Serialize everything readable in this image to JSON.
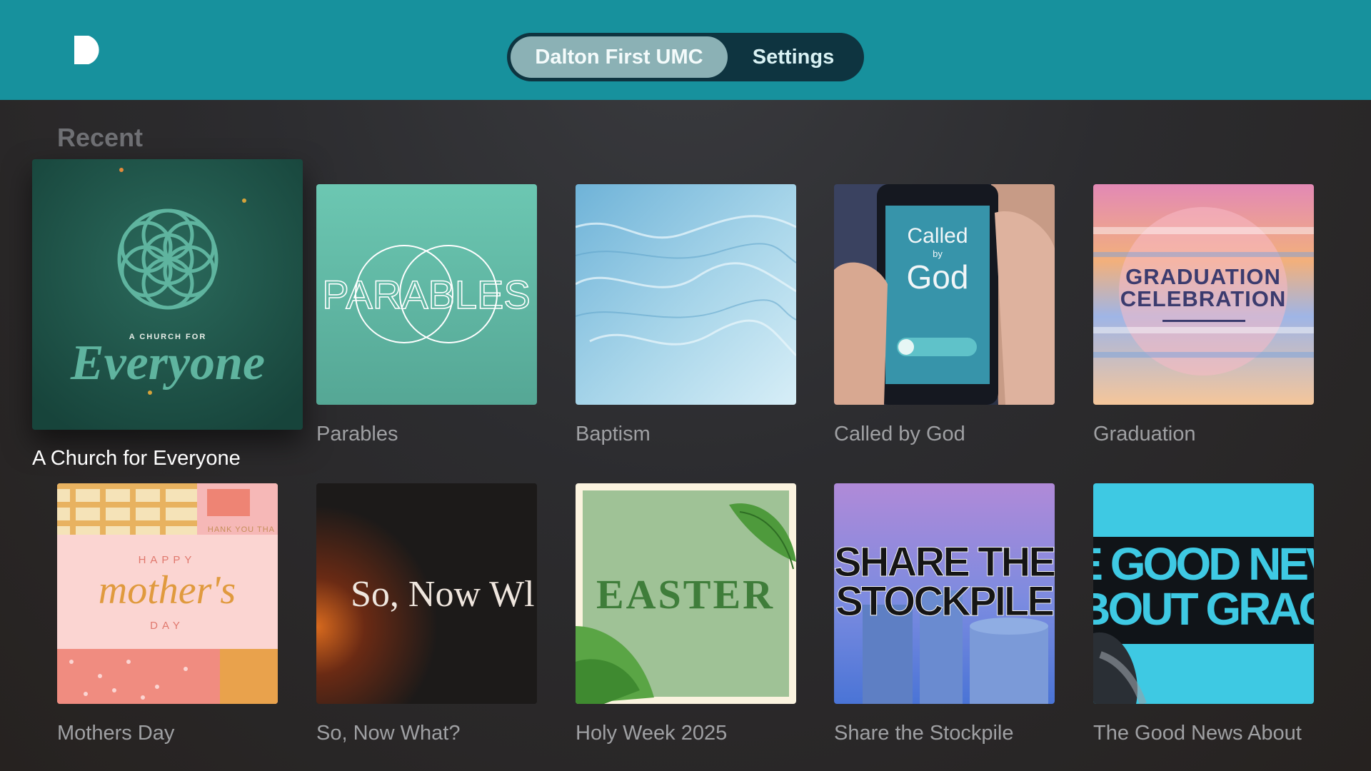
{
  "header": {
    "logo_icon": "app-logo-d-icon",
    "tabs": [
      {
        "label": "Dalton First UMC",
        "active": true
      },
      {
        "label": "Settings",
        "active": false
      }
    ]
  },
  "recent": {
    "title": "Recent",
    "items": [
      {
        "label": "A Church for Everyone",
        "focused": true,
        "art_text": [
          "A CHURCH FOR",
          "Everyone"
        ]
      },
      {
        "label": "Parables",
        "art_text": [
          "PARABLES"
        ]
      },
      {
        "label": "Baptism",
        "art_text": []
      },
      {
        "label": "Called by God",
        "art_text": [
          "Called",
          "by",
          "God"
        ]
      },
      {
        "label": "Graduation",
        "art_text": [
          "GRADUATION",
          "CELEBRATION"
        ]
      },
      {
        "label": "Mothers Day",
        "art_text": [
          "HAPPY",
          "mother's",
          "DAY",
          "HANK YOU THA"
        ]
      },
      {
        "label": "So, Now What?",
        "art_text": [
          "So, Now Wl"
        ]
      },
      {
        "label": "Holy Week 2025",
        "art_text": [
          "EASTER"
        ]
      },
      {
        "label": "Share the Stockpile",
        "art_text": [
          "SHARE THE",
          "STOCKPILE"
        ]
      },
      {
        "label": "The Good News About",
        "art_text": [
          "E GOOD NEV",
          "BOUT GRAC"
        ]
      }
    ]
  }
}
